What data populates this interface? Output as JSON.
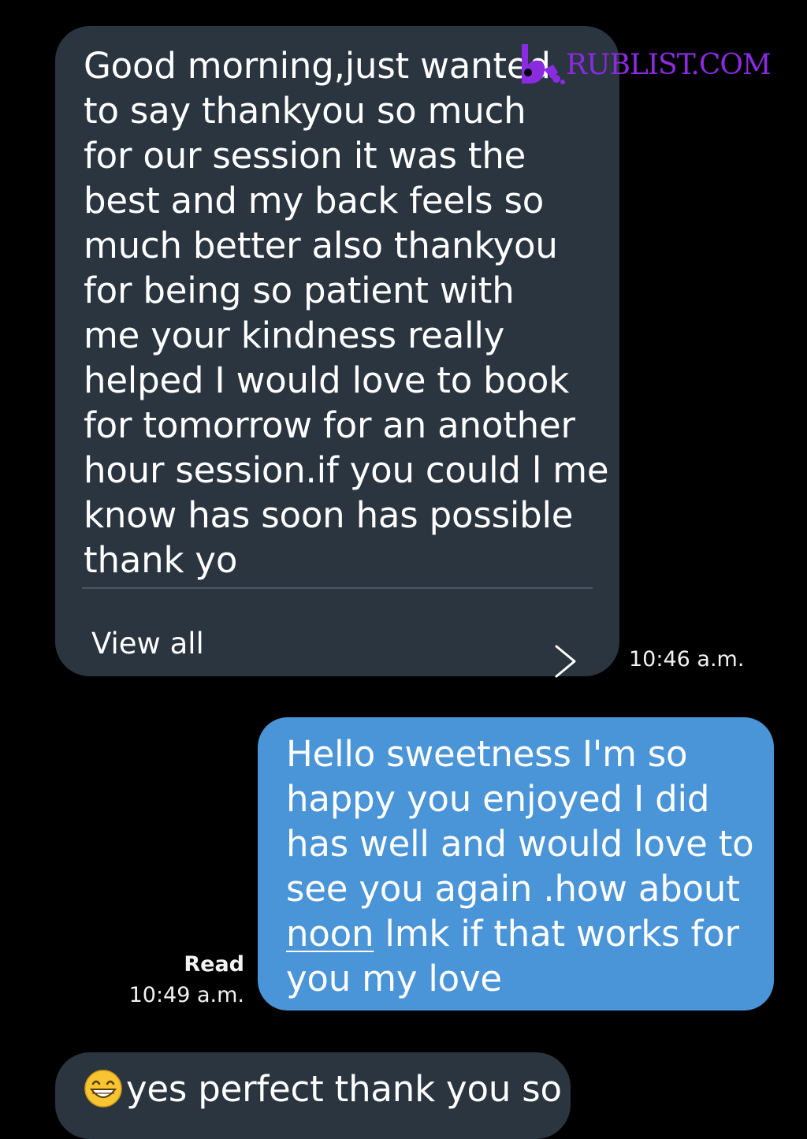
{
  "conversation": {
    "incoming_message_1": {
      "lines": [
        "Good morning,just wanted",
        "to say thankyou so much",
        "for our session it was the",
        "best and my back feels so",
        "much better also thankyou",
        "for being so patient with",
        "me your kindness really",
        "helped I would love to book",
        "for tomorrow for an another",
        "hour session.if you could l me",
        "know has soon has possible",
        "thank yo"
      ],
      "view_all_label": "View all",
      "timestamp": "10:46 a.m."
    },
    "outgoing_message_1": {
      "lines": [
        "Hello sweetness I'm so",
        "happy you enjoyed I did",
        "has well and would love to",
        "see you again .how about"
      ],
      "link_text": "noon",
      "line5_rest": " lmk if that works for",
      "line6": "you my love",
      "read_status": "Read",
      "timestamp": "10:49 a.m."
    },
    "incoming_message_2": {
      "emoji_icon": "grinning-face-icon",
      "text": "yes perfect thank you so"
    }
  },
  "watermark": {
    "text": "RUBLIST.COM",
    "color": "#8a2be2"
  },
  "colors": {
    "background": "#000000",
    "incoming_bubble": "#2a3540",
    "outgoing_bubble": "#4a94d8",
    "text": "#ffffff"
  }
}
